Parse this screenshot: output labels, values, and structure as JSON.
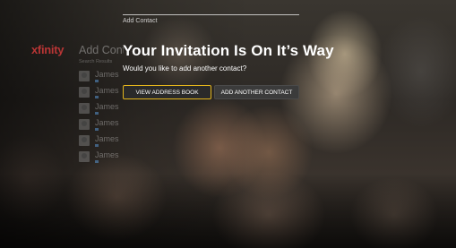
{
  "brand": {
    "logo_text": "xfinity",
    "logo_color": "#d33a3a"
  },
  "background_panel": {
    "heading": "Add Contact",
    "subheading": "Search Results",
    "contacts": [
      {
        "name": "James"
      },
      {
        "name": "James"
      },
      {
        "name": "James"
      },
      {
        "name": "James"
      },
      {
        "name": "James"
      },
      {
        "name": "James"
      }
    ]
  },
  "dialog": {
    "label": "Add Contact",
    "title": "Your Invitation Is On It’s Way",
    "message": "Would you like to add another contact?",
    "buttons": {
      "view_address_book": "VIEW ADDRESS BOOK",
      "add_another_contact": "ADD ANOTHER CONTACT"
    },
    "focus_color": "#e3b51c"
  }
}
